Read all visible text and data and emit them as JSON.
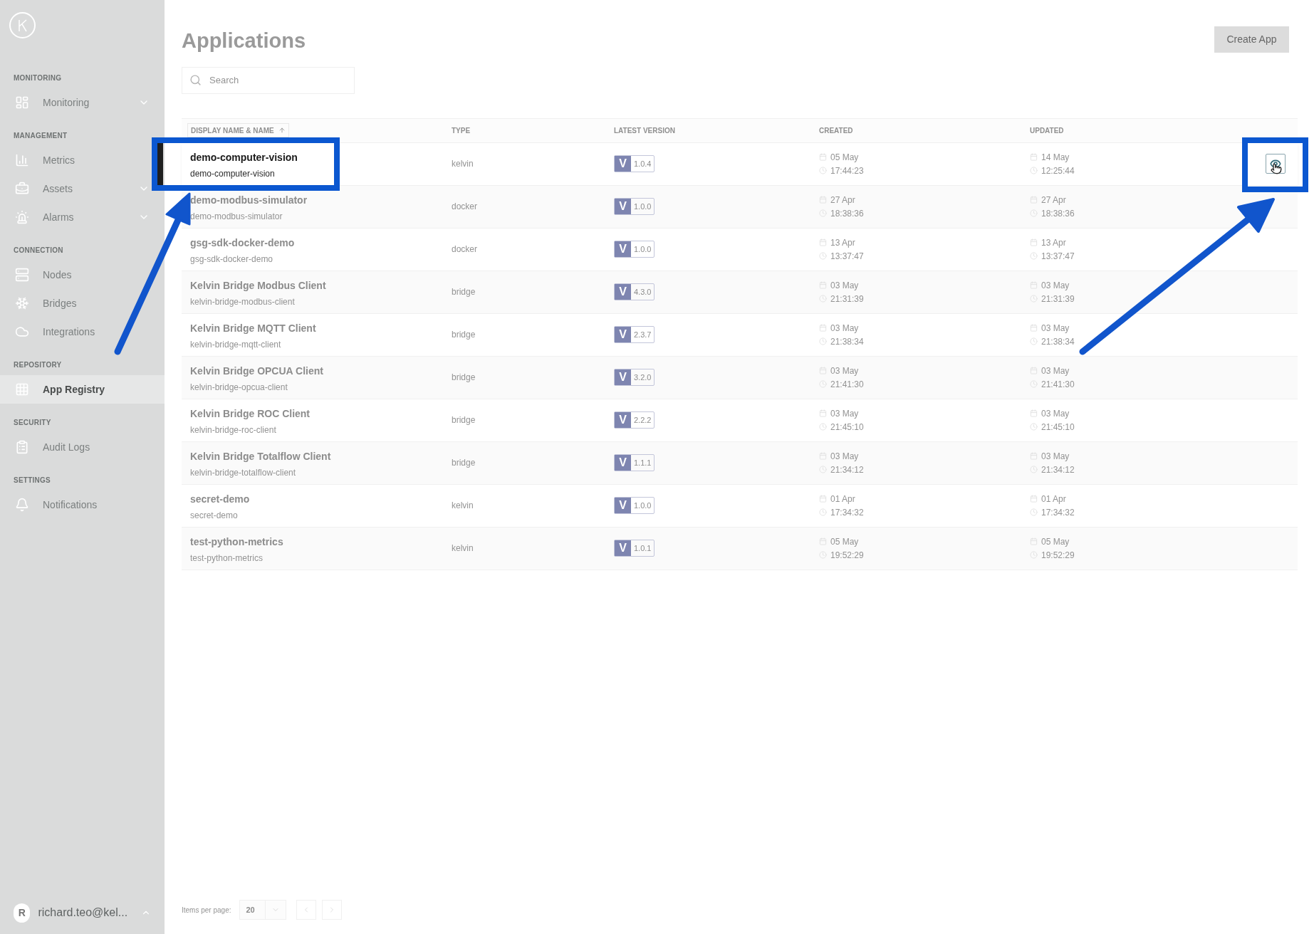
{
  "sidebar": {
    "sections": [
      {
        "label": "MONITORING",
        "items": [
          {
            "label": "Monitoring",
            "selected": false,
            "expandable": true
          }
        ]
      },
      {
        "label": "MANAGEMENT",
        "items": [
          {
            "label": "Metrics",
            "selected": false,
            "expandable": false
          },
          {
            "label": "Assets",
            "selected": false,
            "expandable": true
          },
          {
            "label": "Alarms",
            "selected": false,
            "expandable": true
          }
        ]
      },
      {
        "label": "CONNECTION",
        "items": [
          {
            "label": "Nodes",
            "selected": false,
            "expandable": false
          },
          {
            "label": "Bridges",
            "selected": false,
            "expandable": false
          },
          {
            "label": "Integrations",
            "selected": false,
            "expandable": false
          }
        ]
      },
      {
        "label": "REPOSITORY",
        "items": [
          {
            "label": "App Registry",
            "selected": true,
            "expandable": false
          }
        ]
      },
      {
        "label": "SECURITY",
        "items": [
          {
            "label": "Audit Logs",
            "selected": false,
            "expandable": false
          }
        ]
      },
      {
        "label": "SETTINGS",
        "items": [
          {
            "label": "Notifications",
            "selected": false,
            "expandable": false
          }
        ]
      }
    ],
    "user": {
      "initial": "R",
      "name": "richard.teo@kel..."
    }
  },
  "page": {
    "title": "Applications",
    "create_button": "Create App",
    "search": {
      "placeholder": "Search"
    }
  },
  "table": {
    "columns": [
      "DISPLAY NAME & NAME",
      "TYPE",
      "LATEST VERSION",
      "CREATED",
      "UPDATED"
    ],
    "rows": [
      {
        "display_name": "demo-computer-vision",
        "name": "demo-computer-vision",
        "type": "kelvin",
        "version_prefix": "V",
        "version": "1.0.4",
        "created_date": "05 May",
        "created_time": "17:44:23",
        "updated_date": "14 May",
        "updated_time": "12:25:44",
        "selected": true
      },
      {
        "display_name": "demo-modbus-simulator",
        "name": "demo-modbus-simulator",
        "type": "docker",
        "version_prefix": "V",
        "version": "1.0.0",
        "created_date": "27 Apr",
        "created_time": "18:38:36",
        "updated_date": "27 Apr",
        "updated_time": "18:38:36",
        "selected": false
      },
      {
        "display_name": "gsg-sdk-docker-demo",
        "name": "gsg-sdk-docker-demo",
        "type": "docker",
        "version_prefix": "V",
        "version": "1.0.0",
        "created_date": "13 Apr",
        "created_time": "13:37:47",
        "updated_date": "13 Apr",
        "updated_time": "13:37:47",
        "selected": false
      },
      {
        "display_name": "Kelvin Bridge Modbus Client",
        "name": "kelvin-bridge-modbus-client",
        "type": "bridge",
        "version_prefix": "V",
        "version": "4.3.0",
        "created_date": "03 May",
        "created_time": "21:31:39",
        "updated_date": "03 May",
        "updated_time": "21:31:39",
        "selected": false
      },
      {
        "display_name": "Kelvin Bridge MQTT Client",
        "name": "kelvin-bridge-mqtt-client",
        "type": "bridge",
        "version_prefix": "V",
        "version": "2.3.7",
        "created_date": "03 May",
        "created_time": "21:38:34",
        "updated_date": "03 May",
        "updated_time": "21:38:34",
        "selected": false
      },
      {
        "display_name": "Kelvin Bridge OPCUA Client",
        "name": "kelvin-bridge-opcua-client",
        "type": "bridge",
        "version_prefix": "V",
        "version": "3.2.0",
        "created_date": "03 May",
        "created_time": "21:41:30",
        "updated_date": "03 May",
        "updated_time": "21:41:30",
        "selected": false
      },
      {
        "display_name": "Kelvin Bridge ROC Client",
        "name": "kelvin-bridge-roc-client",
        "type": "bridge",
        "version_prefix": "V",
        "version": "2.2.2",
        "created_date": "03 May",
        "created_time": "21:45:10",
        "updated_date": "03 May",
        "updated_time": "21:45:10",
        "selected": false
      },
      {
        "display_name": "Kelvin Bridge Totalflow Client",
        "name": "kelvin-bridge-totalflow-client",
        "type": "bridge",
        "version_prefix": "V",
        "version": "1.1.1",
        "created_date": "03 May",
        "created_time": "21:34:12",
        "updated_date": "03 May",
        "updated_time": "21:34:12",
        "selected": false
      },
      {
        "display_name": "secret-demo",
        "name": "secret-demo",
        "type": "kelvin",
        "version_prefix": "V",
        "version": "1.0.0",
        "created_date": "01 Apr",
        "created_time": "17:34:32",
        "updated_date": "01 Apr",
        "updated_time": "17:34:32",
        "selected": false
      },
      {
        "display_name": "test-python-metrics",
        "name": "test-python-metrics",
        "type": "kelvin",
        "version_prefix": "V",
        "version": "1.0.1",
        "created_date": "05 May",
        "created_time": "19:52:29",
        "updated_date": "05 May",
        "updated_time": "19:52:29",
        "selected": false
      }
    ]
  },
  "pagination": {
    "label": "Items per page:",
    "page_size": "20"
  }
}
